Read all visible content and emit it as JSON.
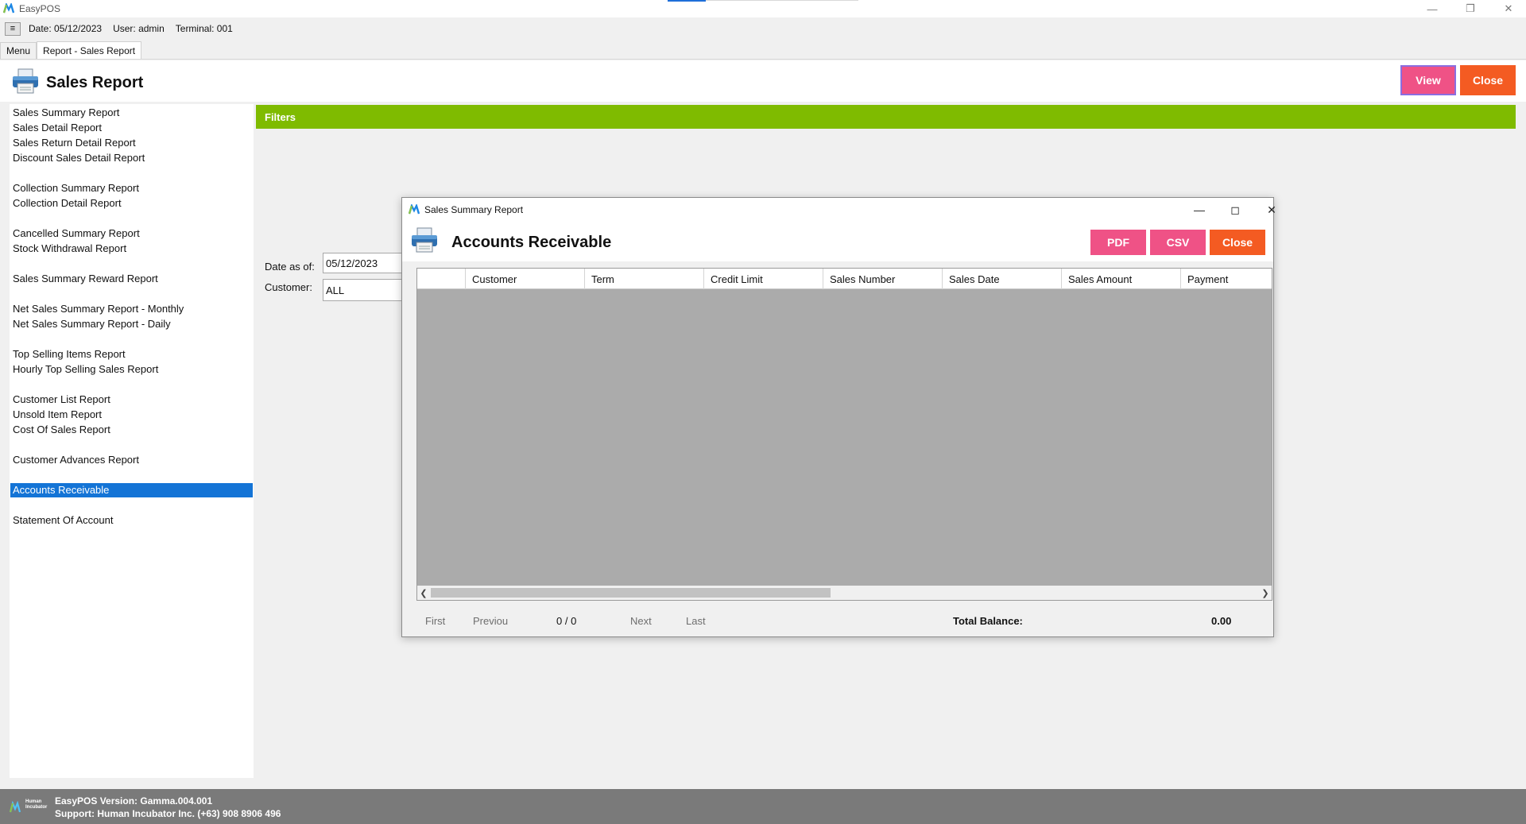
{
  "app": {
    "title": "EasyPOS"
  },
  "infobar": {
    "menu_glyph": "≡",
    "date": "Date: 05/12/2023",
    "user": "User: admin",
    "terminal": "Terminal: 001"
  },
  "tabs": [
    {
      "label": "Menu"
    },
    {
      "label": "Report - Sales Report"
    }
  ],
  "page": {
    "title": "Sales Report"
  },
  "actions": {
    "view_label": "View",
    "close_label": "Close"
  },
  "sidebar": {
    "items": [
      {
        "label": "Sales Summary Report"
      },
      {
        "label": "Sales Detail Report"
      },
      {
        "label": "Sales Return Detail Report"
      },
      {
        "label": "Discount Sales Detail Report"
      },
      {
        "label": "Collection Summary Report"
      },
      {
        "label": "Collection Detail Report"
      },
      {
        "label": "Cancelled Summary Report"
      },
      {
        "label": "Stock Withdrawal Report"
      },
      {
        "label": "Sales Summary Reward Report"
      },
      {
        "label": "Net Sales Summary Report - Monthly"
      },
      {
        "label": "Net Sales Summary Report - Daily"
      },
      {
        "label": "Top Selling Items Report"
      },
      {
        "label": "Hourly Top Selling Sales Report"
      },
      {
        "label": "Customer List Report"
      },
      {
        "label": "Unsold Item Report"
      },
      {
        "label": "Cost Of Sales Report"
      },
      {
        "label": "Customer Advances Report"
      },
      {
        "label": "Accounts Receivable",
        "selected": true
      },
      {
        "label": "Statement Of Account"
      }
    ]
  },
  "filters": {
    "title": "Filters",
    "date_label": "Date as of:",
    "date_value": "05/12/2023",
    "customer_label": "Customer:",
    "customer_value": "ALL"
  },
  "dialog": {
    "window_title": "Sales Summary Report",
    "heading": "Accounts Receivable",
    "pdf_label": "PDF",
    "csv_label": "CSV",
    "close_label": "Close",
    "columns": [
      "",
      "Customer",
      "Term",
      "Credit Limit",
      "Sales Number",
      "Sales Date",
      "Sales Amount",
      "Payment"
    ],
    "pager": {
      "first": "First",
      "previous": "Previou",
      "page_count": "0 / 0",
      "next": "Next",
      "last": "Last"
    },
    "total_label": "Total Balance:",
    "total_value": "0.00"
  },
  "footer": {
    "logo_text": "Human Incubator",
    "version": "EasyPOS Version: Gamma.004.001",
    "support": "Support: Human Incubator Inc. (+63) 908 8906 496"
  },
  "colors": {
    "accent_green": "#7fbb00",
    "pink_button": "#ef5286",
    "orange_button": "#f45b22",
    "selection_blue": "#1474d6",
    "footer_gray": "#7a7a7a"
  }
}
